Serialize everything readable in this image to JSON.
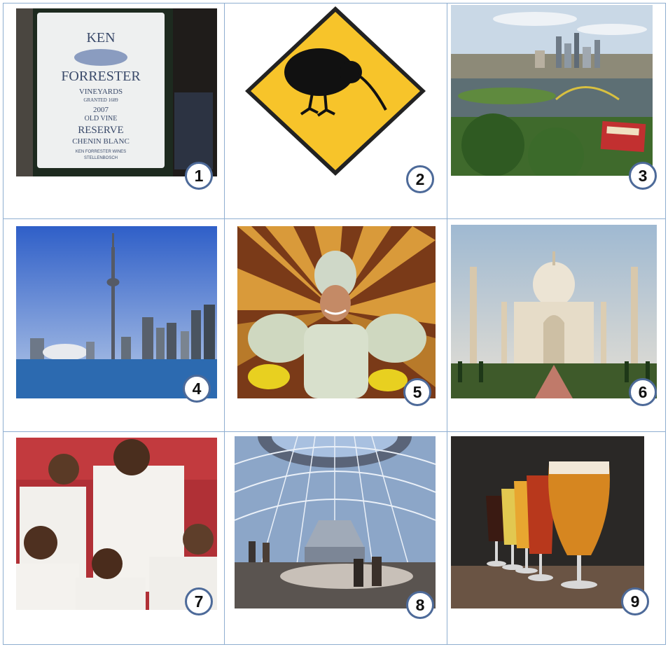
{
  "tiles": [
    {
      "number": "1",
      "label_lines": [
        "KEN",
        "FORRESTER",
        "VINEYARDS",
        "GRANTED 1689",
        "2007",
        "OLD VINE",
        "RESERVE",
        "CHENIN BLANC",
        "KEN FORRESTER WINES",
        "STELLENBOSCH"
      ]
    },
    {
      "number": "2"
    },
    {
      "number": "3"
    },
    {
      "number": "4"
    },
    {
      "number": "5"
    },
    {
      "number": "6"
    },
    {
      "number": "7"
    },
    {
      "number": "8"
    },
    {
      "number": "9"
    }
  ],
  "colors": {
    "grid_line": "#8faed0",
    "badge_border": "#4d6a99",
    "sign_yellow": "#f7c42a"
  }
}
